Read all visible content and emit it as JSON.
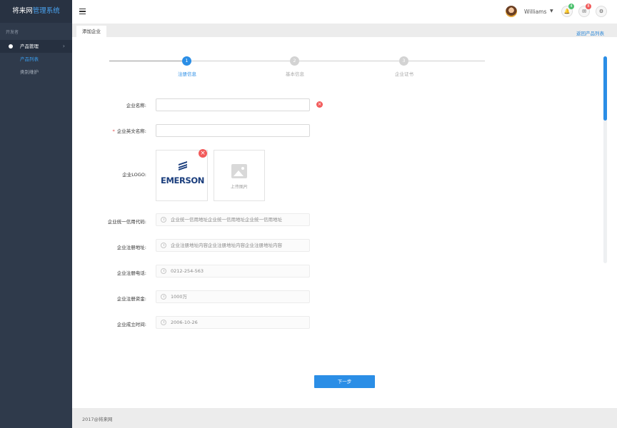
{
  "sidebar": {
    "brand_main": "将来网",
    "brand_highlight": "管理系统",
    "group_title": "开发者",
    "menu_item": "产品管理",
    "sub_items": [
      "产品列表",
      "类别维护"
    ]
  },
  "topbar": {
    "username": "Williams",
    "bell_count": "4",
    "mail_count": "8"
  },
  "tabs": {
    "active_tab": "添加企业",
    "back_link": "返回产品列表"
  },
  "steps": [
    {
      "number": "1",
      "label": "注册信息",
      "active": true
    },
    {
      "number": "2",
      "label": "基本信息",
      "active": false
    },
    {
      "number": "3",
      "label": "企业证书",
      "active": false
    }
  ],
  "form": {
    "company_name_label": "企业名称:",
    "company_name_value": "",
    "english_name_label": "企业英文名称:",
    "english_name_value": "",
    "logo_label": "企业LOGO:",
    "logo_text": "EMERSON",
    "upload_label": "上传图片",
    "credit_code_label": "企业统一信用代码:",
    "credit_code_value": "企业统一信用地址企业统一信用地址企业统一信用地址",
    "reg_address_label": "企业注册地址:",
    "reg_address_value": "企业注册地址内容企业注册地址内容企业注册地址内容",
    "reg_phone_label": "企业注册电话:",
    "reg_phone_value": "0212-254-563",
    "reg_capital_label": "企业注册资金:",
    "reg_capital_value": "1000万",
    "founded_label": "企业成立时间:",
    "founded_value": "2006-10-26",
    "next_button": "下一步"
  },
  "footer": {
    "copyright": "2017@将来网"
  }
}
